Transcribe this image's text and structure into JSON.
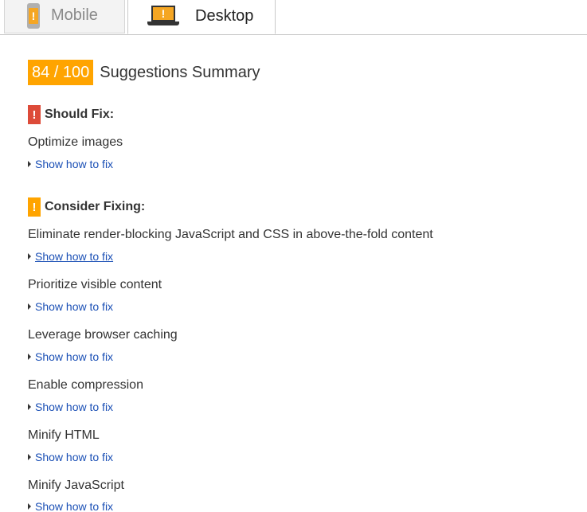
{
  "tabs": {
    "mobile": {
      "label": "Mobile",
      "icon": "mobile-phone-warning-icon"
    },
    "desktop": {
      "label": "Desktop",
      "icon": "desktop-laptop-warning-icon",
      "selected": true
    }
  },
  "summary": {
    "score": "84 / 100",
    "title": "Suggestions Summary",
    "score_color": "#ffa400"
  },
  "should_fix": {
    "heading": "Should Fix:",
    "flag": "!",
    "flag_color": "#dd4b39",
    "rules": [
      {
        "title": "Optimize images",
        "link": "Show how to fix"
      }
    ]
  },
  "consider_fixing": {
    "heading": "Consider Fixing:",
    "flag": "!",
    "flag_color": "#ffa400",
    "rules": [
      {
        "title": "Eliminate render-blocking JavaScript and CSS in above-the-fold content",
        "link": "Show how to fix"
      },
      {
        "title": "Prioritize visible content",
        "link": "Show how to fix"
      },
      {
        "title": "Leverage browser caching",
        "link": "Show how to fix"
      },
      {
        "title": "Enable compression",
        "link": "Show how to fix"
      },
      {
        "title": "Minify HTML",
        "link": "Show how to fix"
      },
      {
        "title": "Minify JavaScript",
        "link": "Show how to fix"
      }
    ]
  },
  "colors": {
    "link": "#1a4fb5",
    "text": "#333333"
  }
}
